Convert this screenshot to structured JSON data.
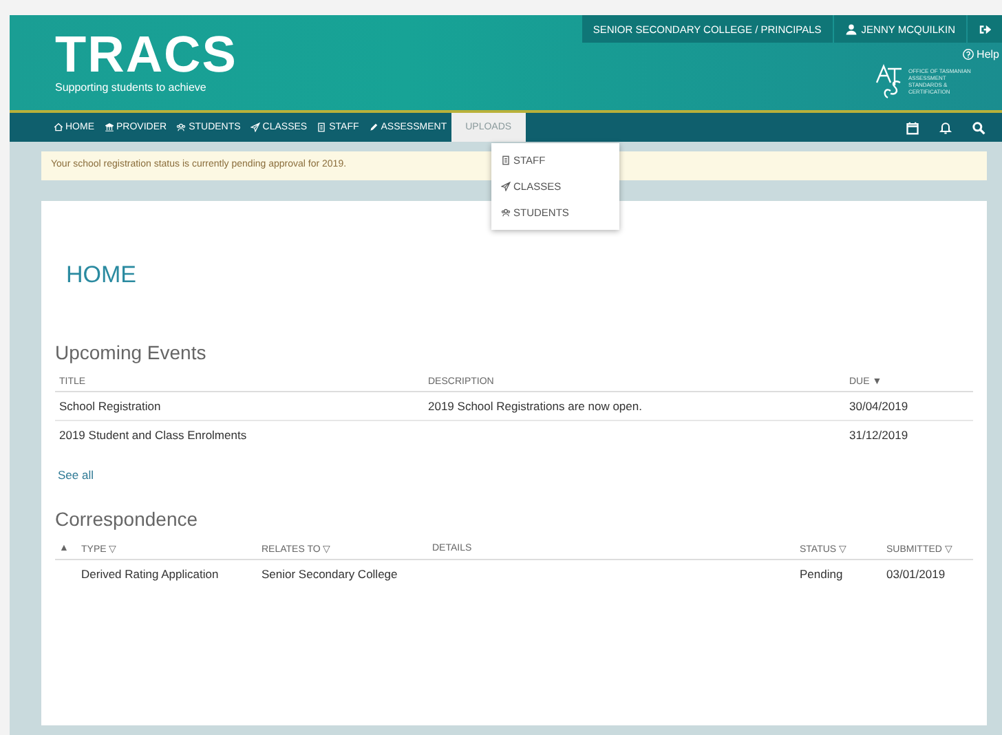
{
  "header": {
    "logo": "TRACS",
    "tagline": "Supporting students to achieve",
    "context": "SENIOR SECONDARY COLLEGE / PRINCIPALS",
    "user": "JENNY MCQUILKIN",
    "help": "Help",
    "agency": "OFFICE OF TASMANIAN ASSESSMENT STANDARDS & CERTIFICATION"
  },
  "nav": [
    {
      "label": "HOME",
      "kind": "home",
      "selected": false
    },
    {
      "label": "PROVIDER",
      "kind": "bank",
      "selected": false
    },
    {
      "label": "STUDENTS",
      "kind": "group",
      "selected": false
    },
    {
      "label": "CLASSES",
      "kind": "plane",
      "selected": false
    },
    {
      "label": "STAFF",
      "kind": "badge",
      "selected": false
    },
    {
      "label": "ASSESSMENT",
      "kind": "pencil",
      "selected": false
    },
    {
      "label": "UPLOADS",
      "kind": "text",
      "selected": true
    }
  ],
  "dropdown": [
    {
      "label": "STAFF",
      "kind": "badge"
    },
    {
      "label": "CLASSES",
      "kind": "plane"
    },
    {
      "label": "STUDENTS",
      "kind": "group"
    }
  ],
  "alert": "Your school registration status is currently pending approval for 2019.",
  "page_title": "HOME",
  "events": {
    "title": "Upcoming Events",
    "columns": [
      "TITLE",
      "DESCRIPTION",
      "DUE ▼"
    ],
    "rows": [
      [
        "School Registration",
        "2019 School Registrations are now open.",
        "30/04/2019"
      ],
      [
        "2019 Student and Class Enrolments",
        "",
        "31/12/2019"
      ]
    ],
    "link": "See all"
  },
  "correspondence": {
    "title": "Correspondence",
    "columns": [
      "▲",
      "TYPE ▽",
      "RELATES TO ▽",
      "DETAILS",
      "STATUS ▽",
      "SUBMITTED ▽"
    ],
    "rows": [
      [
        "",
        "Derived Rating Application",
        "Senior Secondary College",
        "",
        "Pending",
        "03/01/2019"
      ]
    ]
  }
}
